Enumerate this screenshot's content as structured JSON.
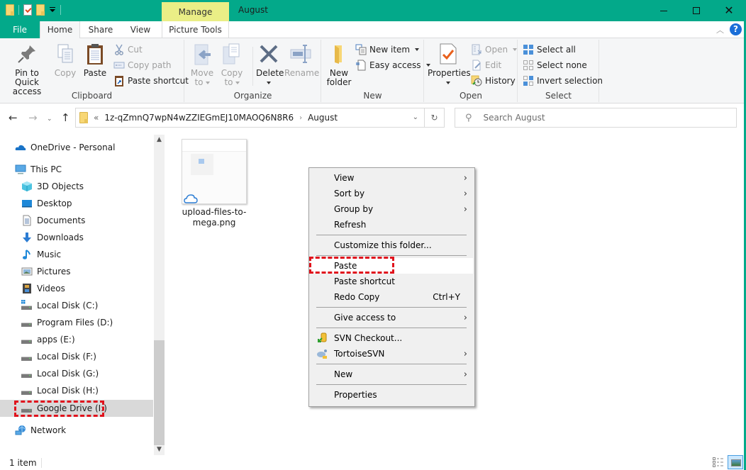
{
  "window": {
    "title": "August",
    "contextual_tab": "Manage",
    "colors": {
      "titlebar": "#03a98a",
      "manage_tab": "#eaee86",
      "highlight_box": "#e0121c"
    }
  },
  "tabs": [
    {
      "label": "File"
    },
    {
      "label": "Home",
      "active": true
    },
    {
      "label": "Share"
    },
    {
      "label": "View"
    },
    {
      "label": "Picture Tools"
    }
  ],
  "ribbon": {
    "clipboard": {
      "label": "Clipboard",
      "pin": "Pin to Quick access",
      "pin_l1": "Pin to Quick",
      "pin_l2": "access",
      "copy": "Copy",
      "paste": "Paste",
      "cut": "Cut",
      "copy_path": "Copy path",
      "paste_shortcut": "Paste shortcut"
    },
    "organize": {
      "label": "Organize",
      "move_l1": "Move",
      "move_l2": "to",
      "copy_l1": "Copy",
      "copy_l2": "to",
      "delete": "Delete",
      "rename": "Rename"
    },
    "new": {
      "label": "New",
      "new_folder_l1": "New",
      "new_folder_l2": "folder",
      "new_item": "New item",
      "easy_access": "Easy access"
    },
    "open": {
      "label": "Open",
      "properties": "Properties",
      "open": "Open",
      "edit": "Edit",
      "history": "History"
    },
    "select": {
      "label": "Select",
      "select_all": "Select all",
      "select_none": "Select none",
      "invert": "Invert selection"
    }
  },
  "address": {
    "overflow": "«",
    "crumbs": [
      "1z-qZmnQ7wpN4wZZIEGmEJ10MAOQ6N8R6",
      "August"
    ],
    "separator": "›"
  },
  "search": {
    "placeholder": "Search August"
  },
  "nav": {
    "items": [
      {
        "label": "OneDrive - Personal",
        "icon": "onedrive-icon"
      },
      {
        "label": "This PC",
        "icon": "pc-icon"
      },
      {
        "label": "3D Objects",
        "icon": "3d-objects-icon"
      },
      {
        "label": "Desktop",
        "icon": "desktop-icon"
      },
      {
        "label": "Documents",
        "icon": "documents-icon"
      },
      {
        "label": "Downloads",
        "icon": "downloads-icon"
      },
      {
        "label": "Music",
        "icon": "music-icon"
      },
      {
        "label": "Pictures",
        "icon": "pictures-icon"
      },
      {
        "label": "Videos",
        "icon": "videos-icon"
      },
      {
        "label": "Local Disk (C:)",
        "icon": "drive-icon"
      },
      {
        "label": "Program Files (D:)",
        "icon": "drive-icon"
      },
      {
        "label": "apps (E:)",
        "icon": "drive-icon"
      },
      {
        "label": "Local Disk (F:)",
        "icon": "drive-icon"
      },
      {
        "label": "Local Disk (G:)",
        "icon": "drive-icon"
      },
      {
        "label": "Local Disk (H:)",
        "icon": "drive-icon"
      },
      {
        "label": "Google Drive (I:)",
        "icon": "drive-icon",
        "selected": true
      },
      {
        "label": "Network",
        "icon": "network-icon"
      }
    ]
  },
  "files": [
    {
      "name": "upload-files-to-mega.png",
      "name_l1": "upload-files-to-",
      "name_l2": "mega.png",
      "status": "cloud-only"
    }
  ],
  "context_menu": {
    "view": "View",
    "sort_by": "Sort by",
    "group_by": "Group by",
    "refresh": "Refresh",
    "customize": "Customize this folder...",
    "paste": "Paste",
    "paste_shortcut": "Paste shortcut",
    "redo_copy": "Redo Copy",
    "redo_copy_shortcut": "Ctrl+Y",
    "give_access": "Give access to",
    "svn_checkout": "SVN Checkout...",
    "tortoise": "TortoiseSVN",
    "new": "New",
    "properties": "Properties",
    "submenu_arrow": "›"
  },
  "status": {
    "item_count": "1 item"
  }
}
